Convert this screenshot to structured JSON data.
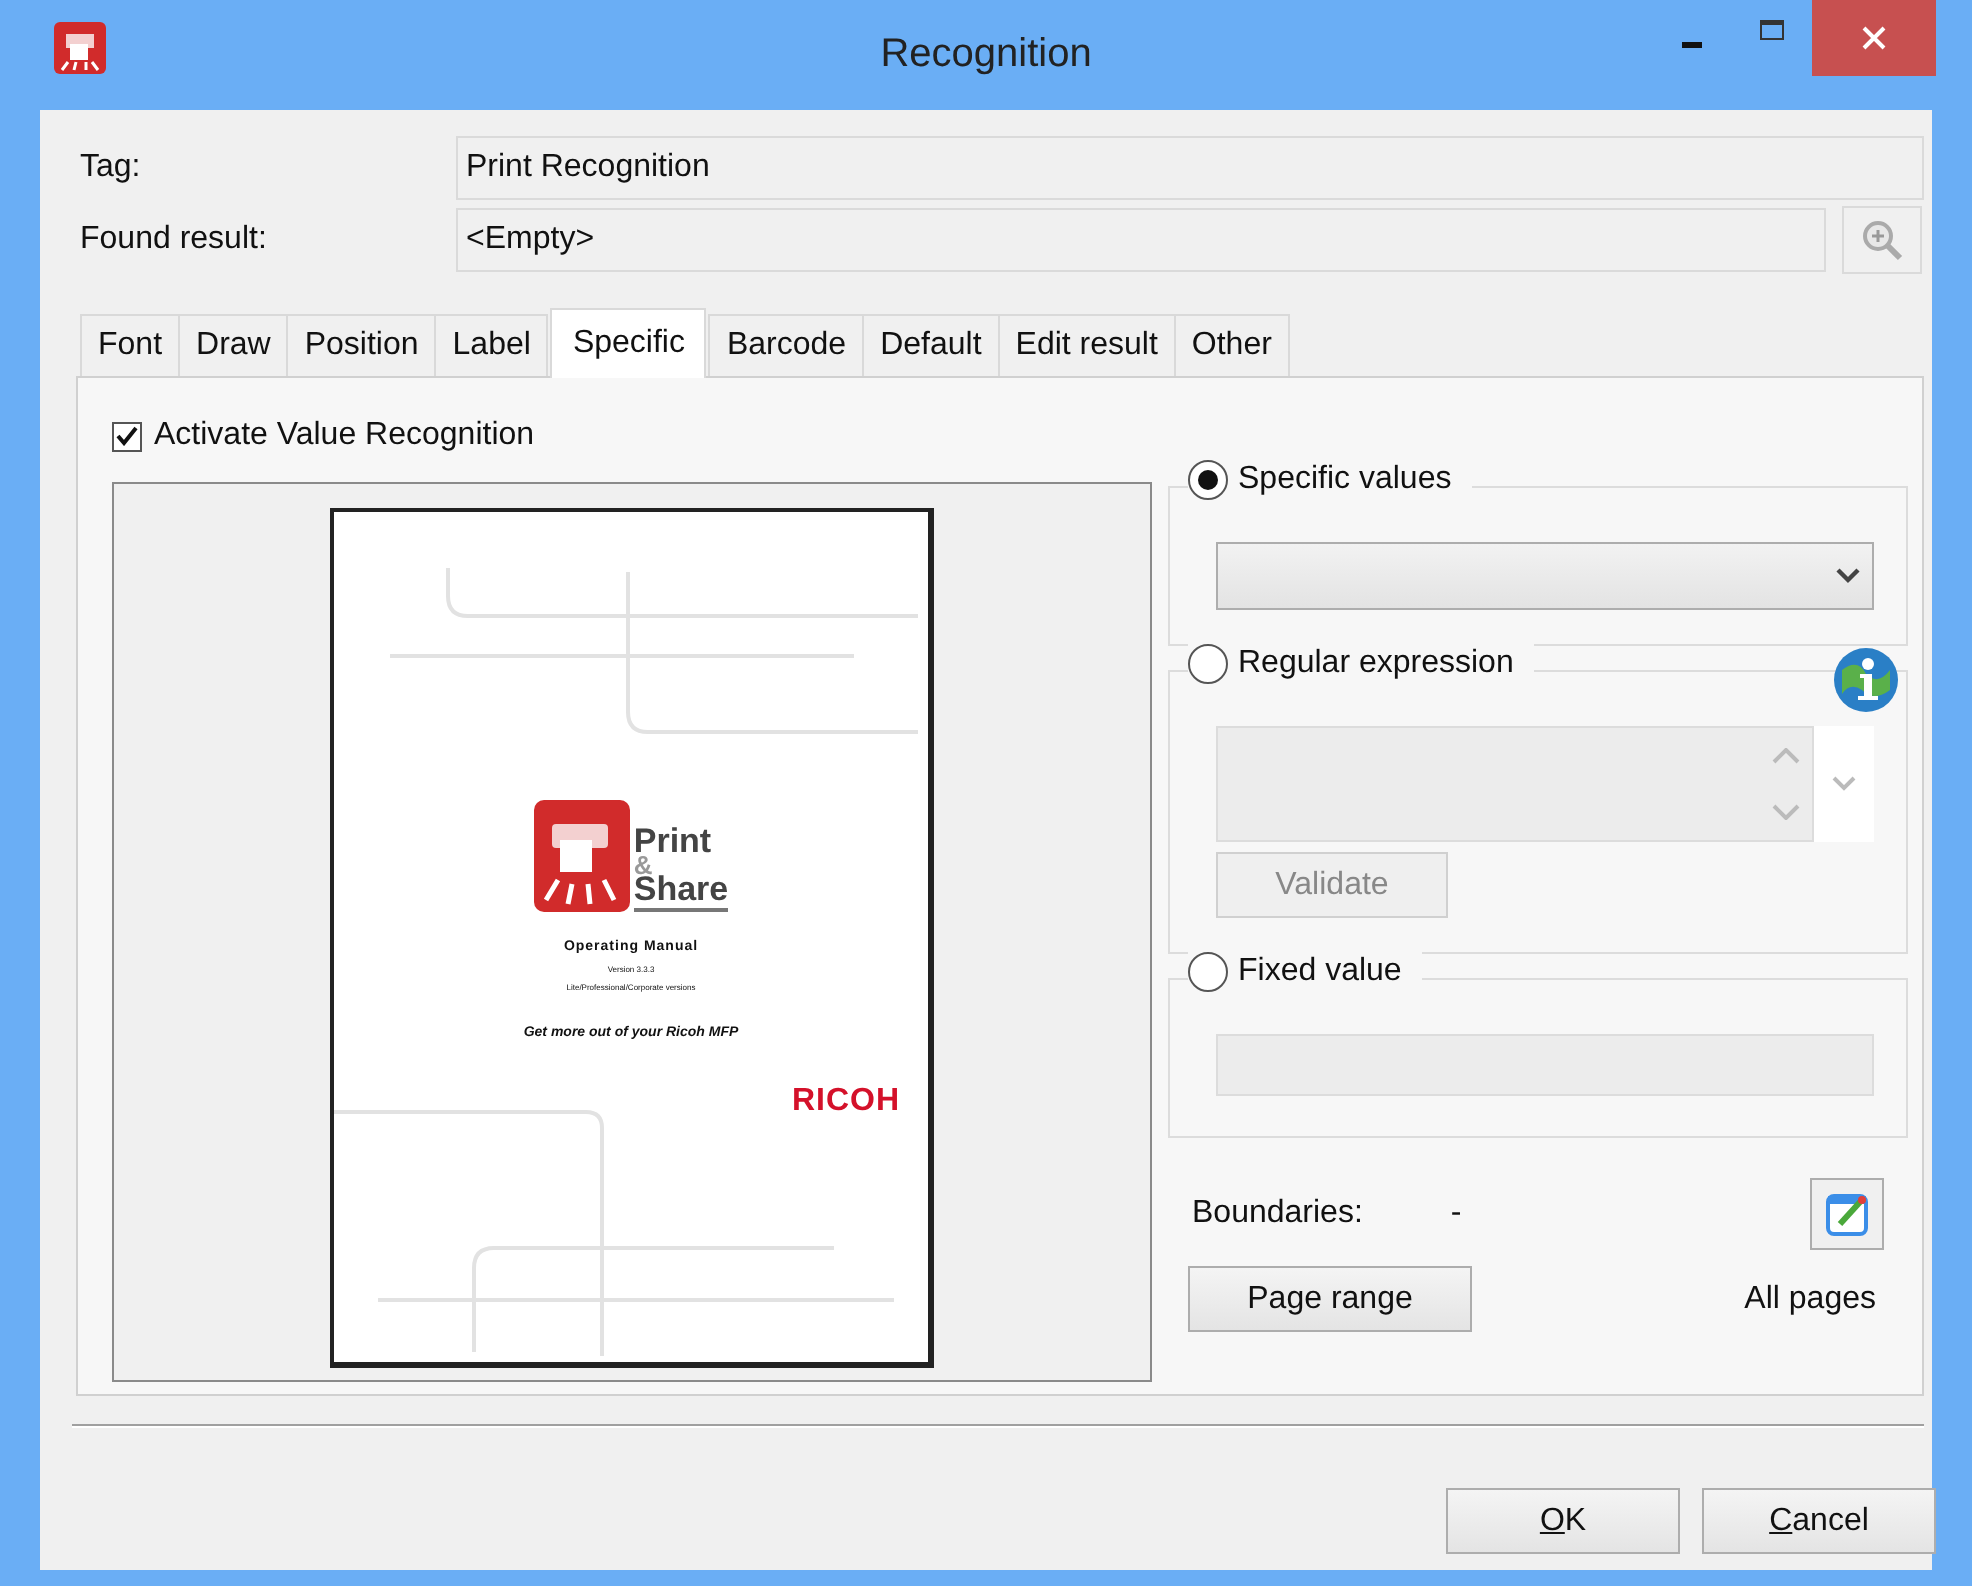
{
  "window": {
    "title": "Recognition"
  },
  "fields": [
    {
      "label": "Tag:",
      "value": "Print Recognition"
    },
    {
      "label": "Found result:",
      "value": "<Empty>"
    }
  ],
  "tabs": [
    {
      "label": "Font",
      "selected": false
    },
    {
      "label": "Draw",
      "selected": false
    },
    {
      "label": "Position",
      "selected": false
    },
    {
      "label": "Label",
      "selected": false
    },
    {
      "label": "Specific",
      "selected": true
    },
    {
      "label": "Barcode",
      "selected": false
    },
    {
      "label": "Default",
      "selected": false
    },
    {
      "label": "Edit result",
      "selected": false
    },
    {
      "label": "Other",
      "selected": false
    }
  ],
  "activate": {
    "label": "Activate Value Recognition",
    "checked": true
  },
  "preview": {
    "logo_lines": [
      "Print",
      "&",
      "Share"
    ],
    "title": "Operating Manual",
    "version": "Version 3.3.3",
    "editions": "Lite/Professional/Corporate versions",
    "tagline": "Get more out of your Ricoh MFP",
    "brand": "RICOH"
  },
  "options": [
    {
      "kind": "dropdown",
      "label": "Specific values",
      "selected": true
    },
    {
      "kind": "regex",
      "label": "Regular expression",
      "selected": false,
      "button": "Validate"
    },
    {
      "kind": "text",
      "label": "Fixed value",
      "selected": false
    }
  ],
  "boundaries": {
    "label": "Boundaries:",
    "value": "-"
  },
  "page_range": {
    "button": "Page range",
    "value": "All pages"
  },
  "buttons": [
    {
      "label": "OK",
      "first_letter_underlined": true
    },
    {
      "label": "Cancel",
      "first_letter_underlined": true
    }
  ]
}
